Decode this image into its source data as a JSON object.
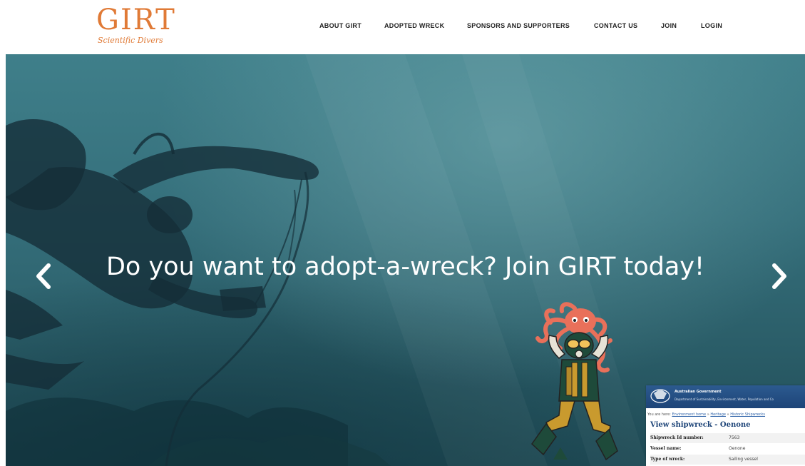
{
  "header": {
    "logo": {
      "main": "GIRT",
      "sub": "Scientific Divers",
      "color": "#e07a36"
    },
    "nav": [
      {
        "label": "ABOUT GIRT"
      },
      {
        "label": "ADOPTED WRECK"
      },
      {
        "label": "SPONSORS AND SUPPORTERS"
      },
      {
        "label": "CONTACT US"
      },
      {
        "label": "JOIN"
      },
      {
        "label": "LOGIN"
      }
    ]
  },
  "hero": {
    "heading": "Do you want to adopt-a-wreck? Join GIRT today!",
    "prev_icon": "chevron-left-icon",
    "next_icon": "chevron-right-icon",
    "background_color": "#3f7f8a"
  },
  "gov_page": {
    "agency": "Australian Government",
    "department": "Department of Sustainability, Environment, Water, Population and Co",
    "breadcrumb_prefix": "You are here:",
    "breadcrumb_links": [
      "Environment home",
      "Heritage",
      "Historic Shipwrecks"
    ],
    "title": "View shipwreck - Oenone",
    "rows": [
      {
        "key": "Shipwreck Id number:",
        "value": "7563"
      },
      {
        "key": "Vessel name:",
        "value": "Oenone"
      },
      {
        "key": "Type of wreck:",
        "value": "Sailing vessel"
      }
    ]
  }
}
